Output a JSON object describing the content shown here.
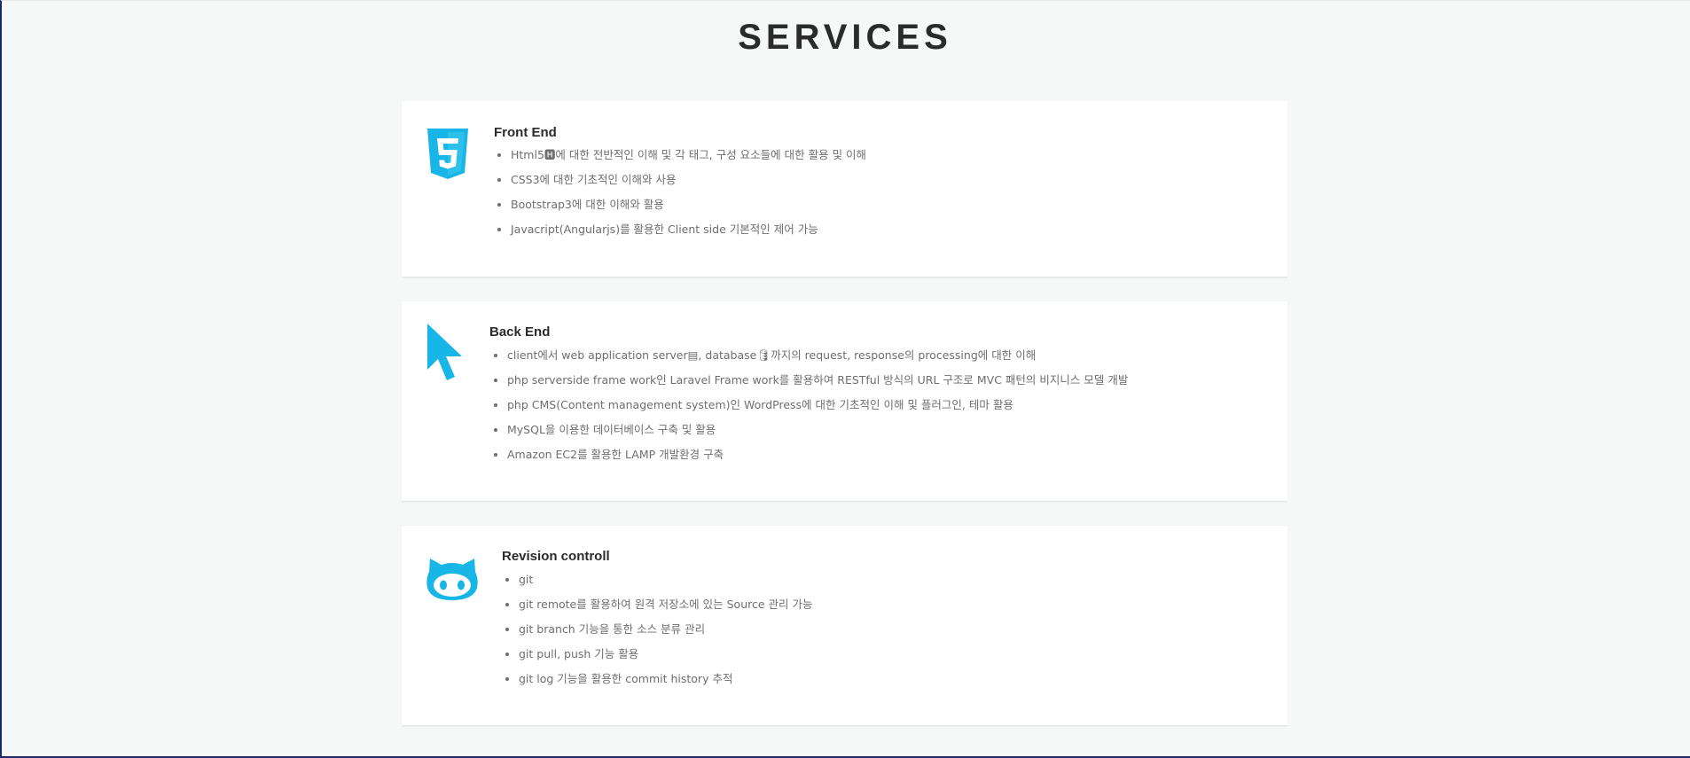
{
  "page": {
    "title": "SERVICES",
    "accent_color": "#17b6e6"
  },
  "sections": [
    {
      "icon": "html5-icon",
      "heading": "Front End",
      "items": [
        "Html5🅷에 대한 전반적인 이해 및 각 태그, 구성 요소들에 대한 활용 및 이해",
        "CSS3에 대한 기초적인 이해와 사용",
        "Bootstrap3에 대한 이해와 활용",
        "Javacript(Angularjs)를 활용한 Client side 기본적인 제어 가능"
      ]
    },
    {
      "icon": "cursor-arrow-icon",
      "heading": "Back End",
      "items": [
        "client에서 web application server▤, database🛢까지의 request, response의 processing에 대한 이해",
        "php serverside frame work인 Laravel Frame work를 활용하여 RESTful 방식의 URL 구조로 MVC 패턴의 비지니스 모델 개발",
        "php CMS(Content management system)인 WordPress에 대한 기초적인 이해 및 플러그인, 테마 활용",
        "MySQL을 이용한 데이터베이스 구축 및 활용",
        " Amazon EC2를 활용한 LAMP 개발환경 구축"
      ]
    },
    {
      "icon": "github-octocat-icon",
      "heading": "Revision controll",
      "items": [
        "git",
        "git remote를 활용하여 원격 저장소에 있는 Source 관리 가능",
        "git branch 기능을 통한 소스 분류 관리",
        "git pull, push 기능 활용",
        "git log 기능을 활용한 commit history 추적"
      ]
    }
  ]
}
